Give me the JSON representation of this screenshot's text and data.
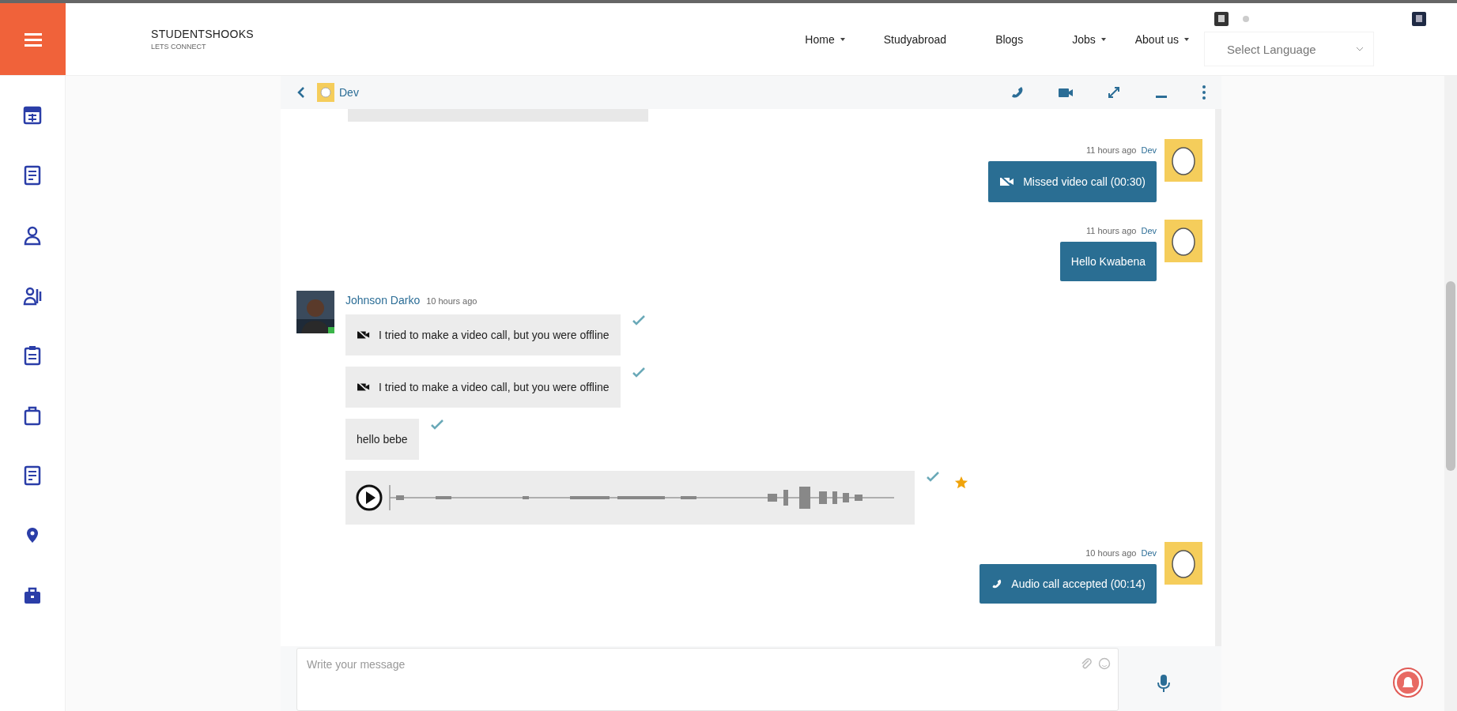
{
  "brand": {
    "title": "STUDENTSHOOKS",
    "subtitle": "LETS CONNECT"
  },
  "nav": [
    {
      "label": "Home",
      "dropdown": true
    },
    {
      "label": "Studyabroad",
      "dropdown": false
    },
    {
      "label": "Blogs",
      "dropdown": false
    },
    {
      "label": "Jobs",
      "dropdown": true
    },
    {
      "label": "About us",
      "dropdown": true
    }
  ],
  "language_select": {
    "placeholder": "Select Language"
  },
  "chat": {
    "contact": "Dev",
    "messages": [
      {
        "kind": "outgoing",
        "time": "11 hours ago",
        "author": "Dev",
        "body": {
          "kind": "missed-video",
          "text": "Missed video call (00:30)"
        }
      },
      {
        "kind": "outgoing",
        "time": "11 hours ago",
        "author": "Dev",
        "body": {
          "kind": "text",
          "text": "Hello Kwabena"
        }
      },
      {
        "kind": "incoming",
        "author": "Johnson Darko",
        "time": "10 hours ago",
        "online": true,
        "items": [
          {
            "kind": "missed-video",
            "text": "I tried to make a video call, but you were offline",
            "delivered": true,
            "starred": false
          },
          {
            "kind": "missed-video",
            "text": "I tried to make a video call, but you were offline",
            "delivered": true,
            "starred": false
          },
          {
            "kind": "text",
            "text": "hello bebe",
            "delivered": true,
            "starred": false
          },
          {
            "kind": "audio",
            "delivered": true,
            "starred": true
          }
        ]
      },
      {
        "kind": "outgoing",
        "time": "10 hours ago",
        "author": "Dev",
        "body": {
          "kind": "audio-call",
          "text": "Audio call accepted (00:14)"
        }
      }
    ],
    "composer": {
      "placeholder": "Write your message"
    }
  }
}
